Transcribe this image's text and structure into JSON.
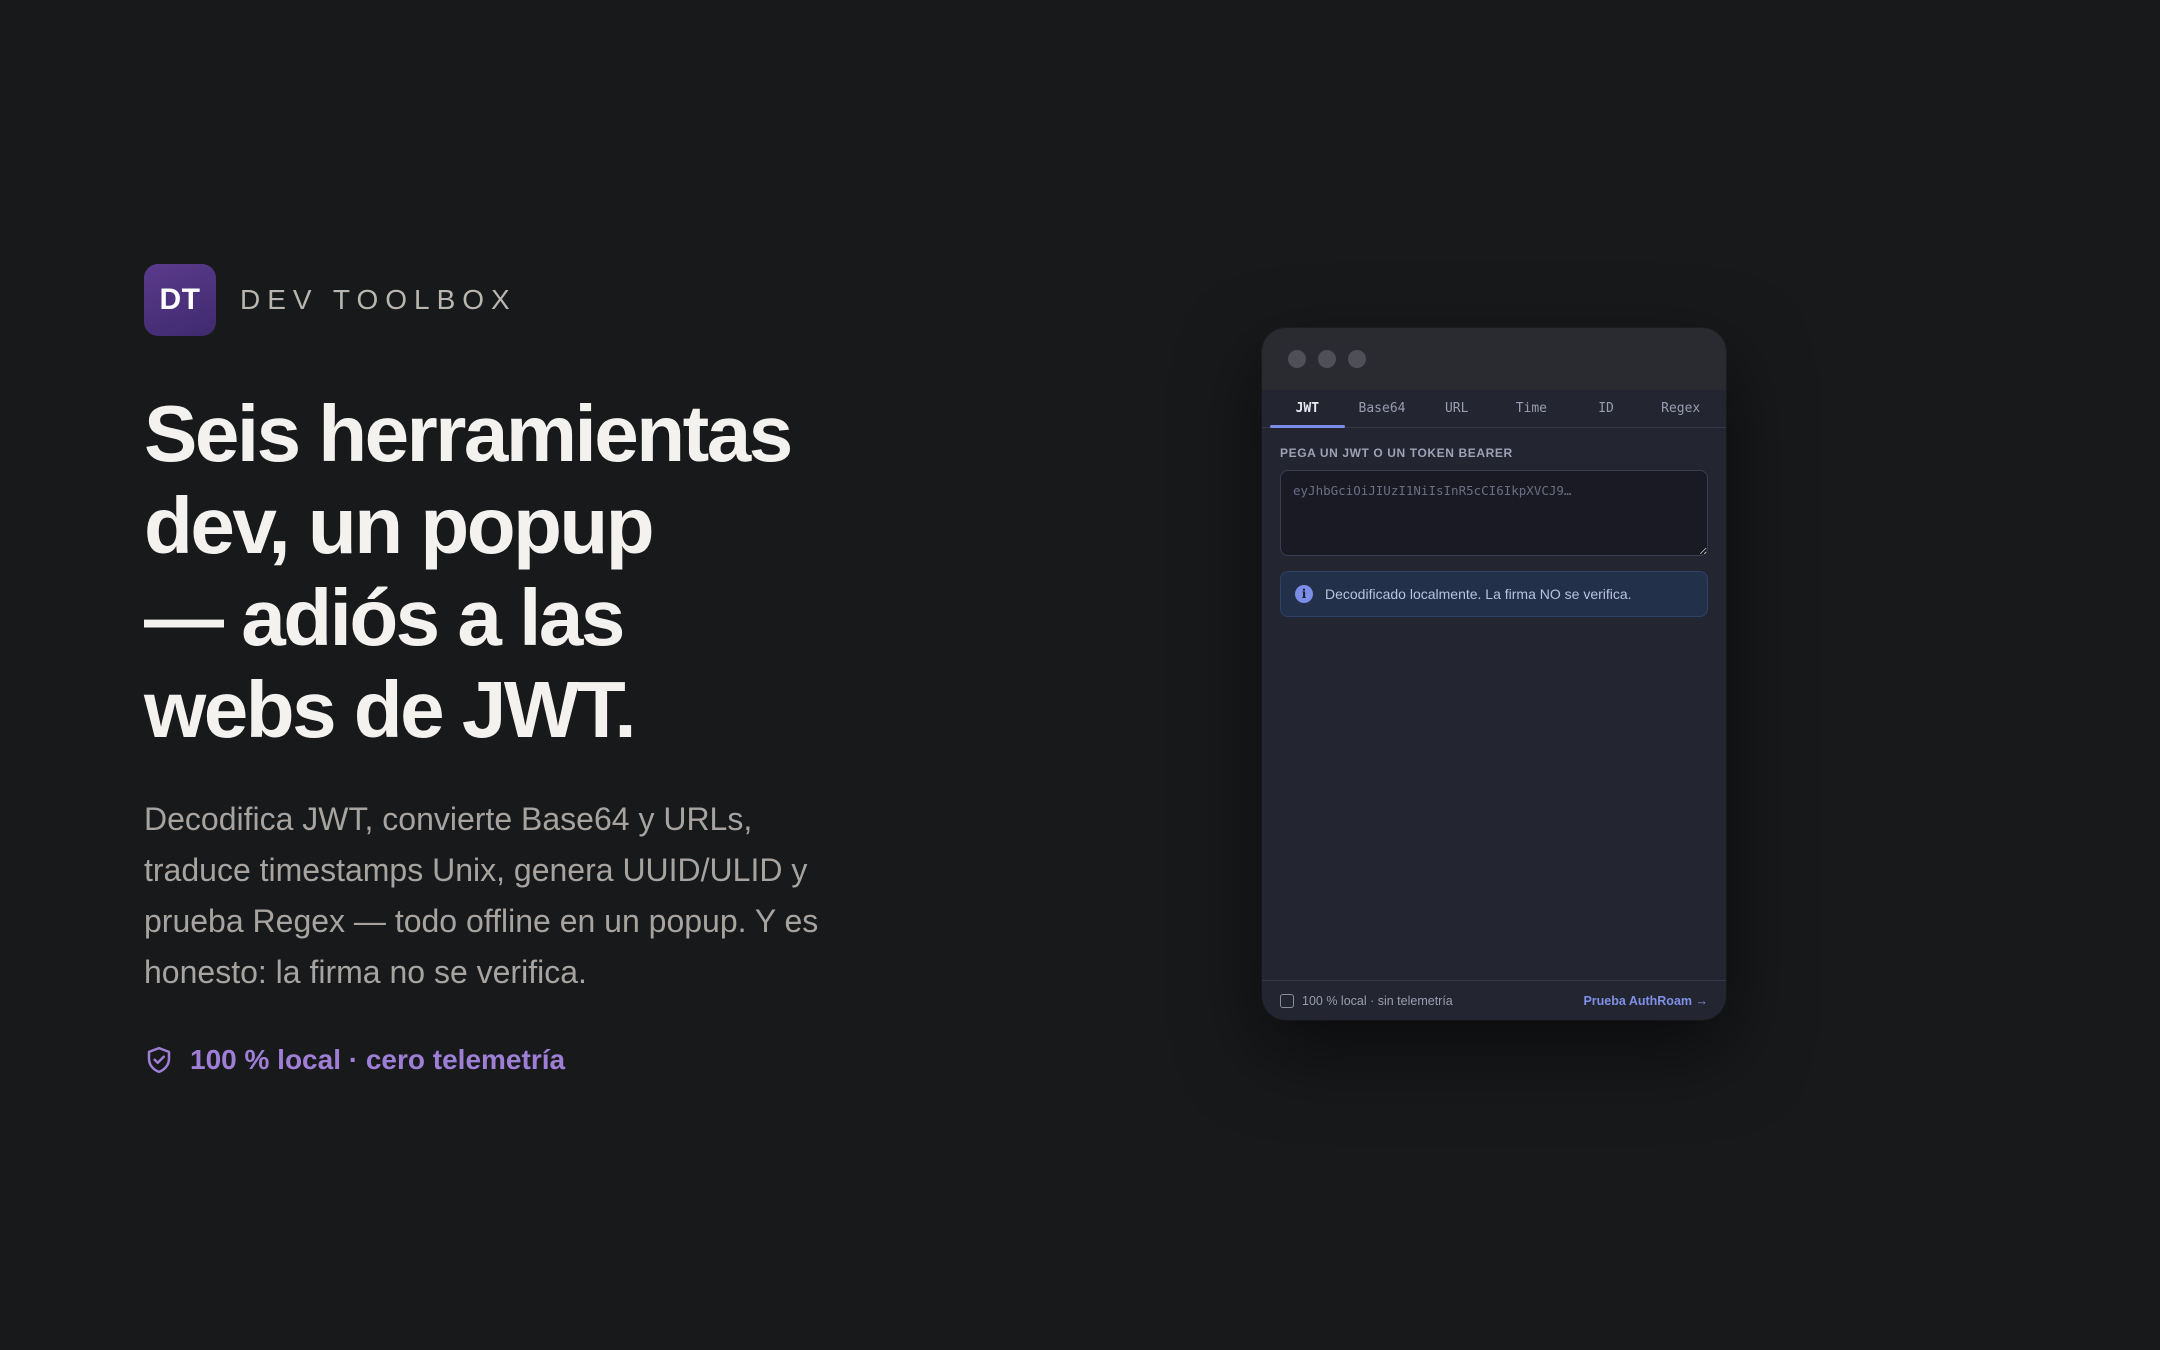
{
  "brand": {
    "logo_text": "DT",
    "name": "DEV TOOLBOX"
  },
  "hero": {
    "headline": [
      "Seis herramientas",
      "dev, un popup",
      "— adiós a las",
      "webs de JWT."
    ],
    "subcopy": "Decodifica JWT, convierte Base64 y URLs, traduce timestamps Unix, genera UUID/ULID y prueba Regex — todo offline en un popup. Y es honesto: la firma no se verifica.",
    "trust_text": "100 % local · cero telemetría",
    "trust_icon": "shield-check-icon"
  },
  "popup": {
    "tabs": [
      {
        "label": "JWT",
        "active": true
      },
      {
        "label": "Base64",
        "active": false
      },
      {
        "label": "URL",
        "active": false
      },
      {
        "label": "Time",
        "active": false
      },
      {
        "label": "ID",
        "active": false
      },
      {
        "label": "Regex",
        "active": false
      }
    ],
    "field_label": "PEGA UN JWT O UN TOKEN BEARER",
    "input_placeholder": "eyJhbGciOiJIUzI1NiIsInR5cCI6IkpXVCJ9…",
    "notice": {
      "icon_glyph": "i",
      "text": "Decodificado localmente. La firma NO se verifica."
    },
    "footer": {
      "left_text": "100 % local · sin telemetría",
      "link_text": "Prueba AuthRoam →"
    }
  },
  "colors": {
    "background": "#18191b",
    "accent_purple": "#9f7fd6",
    "tab_active_underline": "#7b8de6",
    "link": "#7f90e6"
  }
}
